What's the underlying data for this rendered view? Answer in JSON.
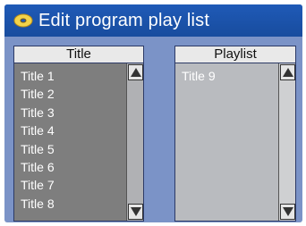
{
  "window": {
    "title": "Edit program play list",
    "icon": "disc-icon"
  },
  "panels": {
    "left": {
      "header": "Title",
      "items": [
        "Title 1",
        "Title 2",
        "Title 3",
        "Title 4",
        "Title 5",
        "Title 6",
        "Title 7",
        "Title 8"
      ]
    },
    "right": {
      "header": "Playlist",
      "items": [
        "Title 9"
      ]
    }
  },
  "icons": {
    "scroll_up": "scroll-up-arrow-icon",
    "scroll_down": "scroll-down-arrow-icon"
  },
  "colors": {
    "titlebar": "#1f5ab7",
    "background": "#7b93c7",
    "left_list_bg": "#7e7e7e",
    "right_list_bg": "#b9bbbf"
  }
}
